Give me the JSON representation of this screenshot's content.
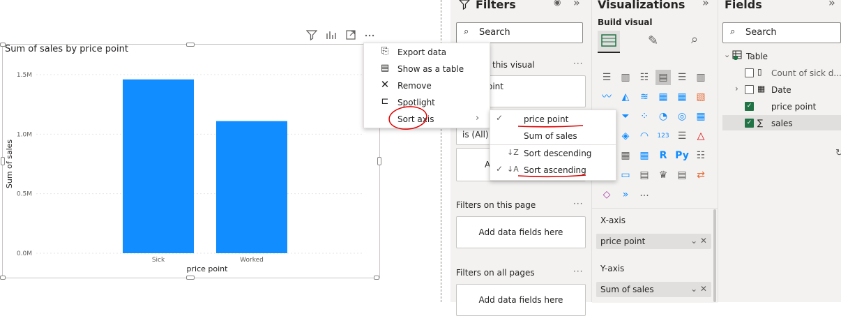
{
  "chart": {
    "title": "Sum of sales by price point",
    "header_icons": [
      "filter-icon",
      "drill-icon",
      "focus-mode-icon",
      "more-options-icon"
    ]
  },
  "chart_data": {
    "type": "bar",
    "title": "Sum of sales by price point",
    "categories": [
      "Sick",
      "Worked"
    ],
    "values": [
      1460000,
      1110000
    ],
    "xlabel": "price point",
    "ylabel": "Sum of sales",
    "ylim": [
      0,
      1500000
    ],
    "yticks": [
      "0.0M",
      "0.5M",
      "1.0M",
      "1.5M"
    ],
    "grid": true,
    "bar_color": "#118DFF"
  },
  "context_menu": {
    "items": [
      {
        "label": "Export data",
        "icon": "export-icon"
      },
      {
        "label": "Show as a table",
        "icon": "table-view-icon"
      },
      {
        "label": "Remove",
        "icon": "close-icon"
      },
      {
        "label": "Spotlight",
        "icon": "spotlight-icon"
      },
      {
        "label": "Sort axis",
        "icon": "",
        "has_submenu": true
      }
    ]
  },
  "sort_submenu": {
    "items": [
      {
        "label": "price point",
        "checked": true
      },
      {
        "label": "Sum of sales",
        "checked": false
      },
      {
        "label": "Sort descending",
        "checked": false,
        "icon": "sort-descending-icon"
      },
      {
        "label": "Sort ascending",
        "checked": true,
        "icon": "sort-ascending-icon"
      }
    ]
  },
  "filters": {
    "title": "Filters",
    "search_label": "Search",
    "this_visual_label": "this visual",
    "field_card_text": "oint",
    "is_all": "is (All)",
    "add_fields_truncated": "A",
    "on_page_label": "Filters on this page",
    "add_fields_label": "Add data fields here",
    "all_pages_label": "Filters on all pages",
    "add_fields_label_2": "Add data fields here"
  },
  "visualizations": {
    "title": "Visualizations",
    "build_visual": "Build visual",
    "x_axis_label": "X-axis",
    "x_axis_field": "price point",
    "y_axis_label": "Y-axis",
    "y_axis_field": "Sum of sales",
    "more": "..."
  },
  "fields": {
    "title": "Fields",
    "search_label": "Search",
    "table_name": "Table",
    "items": [
      {
        "label": "Count of sick d...",
        "checked": false
      },
      {
        "label": "Date",
        "checked": false
      },
      {
        "label": "price point",
        "checked": true
      },
      {
        "label": "sales",
        "checked": true
      }
    ]
  },
  "colors": {
    "bar": "#118DFF",
    "annotation_red": "#e00000",
    "check_green": "#217346"
  }
}
